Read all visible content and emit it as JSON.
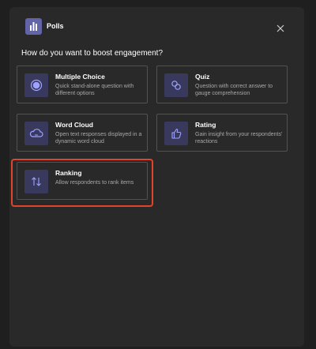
{
  "app": {
    "title": "Polls",
    "icon": "polls-bar-chart-icon",
    "close_icon": "close-icon"
  },
  "question": "How do you want to boost engagement?",
  "options": [
    {
      "title": "Multiple Choice",
      "description": "Quick stand-alone question with different options",
      "icon": "radio-button-icon"
    },
    {
      "title": "Quiz",
      "description": "Question with correct answer to gauge comprehension",
      "icon": "quiz-link-icon"
    },
    {
      "title": "Word Cloud",
      "description": "Open text responses displayed in a dynamic word cloud",
      "icon": "cloud-icon"
    },
    {
      "title": "Rating",
      "description": "Gain insight from your respondents' reactions",
      "icon": "thumbs-up-icon"
    },
    {
      "title": "Ranking",
      "description": "Allow respondents to rank items",
      "icon": "rank-arrows-icon"
    }
  ],
  "colors": {
    "accent": "#6264a7",
    "highlight": "#e0452b",
    "background": "#292929"
  }
}
